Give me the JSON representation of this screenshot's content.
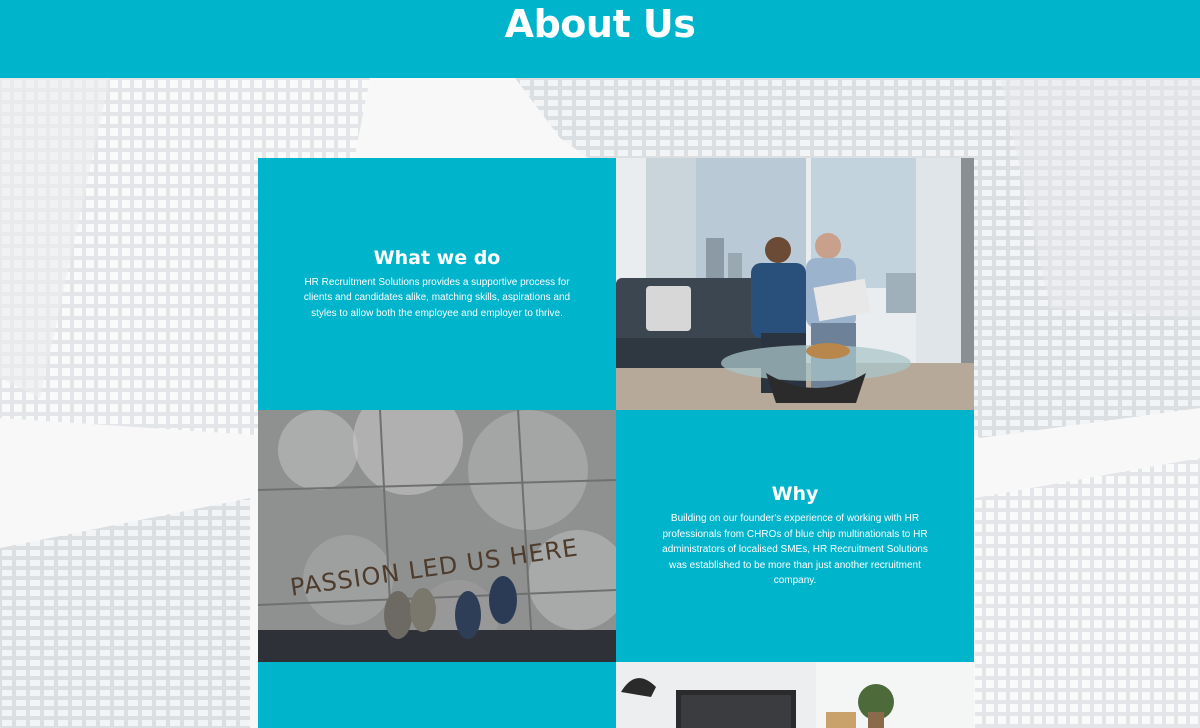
{
  "header": {
    "title": "About Us"
  },
  "sections": [
    {
      "title": "What we do",
      "body": "HR Recruitment Solutions provides a supportive process for clients and candidates alike, matching skills, aspirations and styles to allow both the employee and employer to thrive."
    },
    {
      "title": "Why",
      "body": "Building on our founder's experience of working with HR professionals from CHROs of blue chip multinationals to HR administrators of localised SMEs, HR Recruitment Solutions was established to be more than just another recruitment company."
    }
  ],
  "images": {
    "passion_text": "PASSION LED US HERE"
  },
  "colors": {
    "brand_cyan": "#00b4cc",
    "background": "#f3f4f6",
    "text_on_brand": "#ffffff"
  }
}
